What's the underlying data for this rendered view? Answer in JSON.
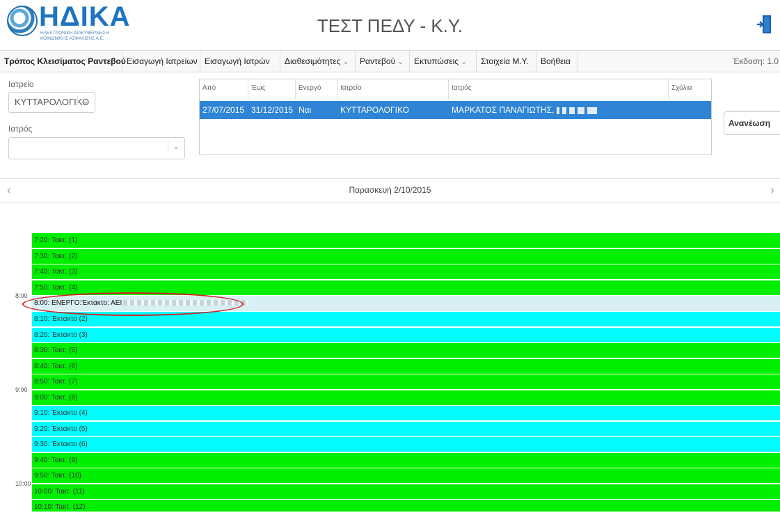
{
  "header": {
    "logo_name": "ΗΔΙΚΑ",
    "logo_sub": "ΗΛΕΚΤΡΟΝΙΚΗ ΔΙΑΚΥΒΕΡΝΗΣΗ ΚΟΙΝΩΝΙΚΗΣ ΑΣΦΑΛΙΣΗΣ Α.Ε.",
    "title": "ΤΕΣΤ ΠΕΔΥ - Κ.Υ."
  },
  "nav": {
    "items": [
      {
        "label": "Τρόπος Κλεισίματος Ραντεβού"
      },
      {
        "label": "Εισαγωγή Ιατρείων"
      },
      {
        "label": "Εισαγωγή Ιατρών"
      },
      {
        "label": "Διαθεσιμότητες"
      },
      {
        "label": "Ραντεβού"
      },
      {
        "label": "Εκτυπώσεις"
      },
      {
        "label": "Στοιχεία Μ.Υ."
      },
      {
        "label": "Βοήθεια"
      }
    ],
    "version": "Έκδοση: 1.0"
  },
  "filters": {
    "office_label": "Ιατρείο",
    "office_value": "ΚΥΤΤΑΡΟΛΟΓΙΚΟ",
    "doctor_label": "Ιατρός",
    "doctor_value": ""
  },
  "grid": {
    "headers": [
      "Από",
      "Έως",
      "Ενεργό",
      "Ιατρείο",
      "Ιατρός",
      "Σχόλια"
    ],
    "rows": [
      {
        "from": "27/07/2015",
        "to": "31/12/2015",
        "active": "Ναι",
        "office": "ΚΥΤΤΑΡΟΛΟΓΙΚΟ",
        "doctor": "ΜΑΡΚΑΤΟΣ ΠΑΝΑΓΙΩΤΗΣ,",
        "comments": ""
      }
    ]
  },
  "refresh_label": "Ανανέωση",
  "day": {
    "title": "Παρασκευή 2/10/2015",
    "prev": "‹",
    "next": "›"
  },
  "hours": [
    "8:00",
    "9:00",
    "10:00"
  ],
  "slots": [
    {
      "label": "7:20: Τακτ. (1)",
      "kind": "green"
    },
    {
      "label": "7:30: Τακτ. (2)",
      "kind": "green"
    },
    {
      "label": "7:40: Τακτ. (3)",
      "kind": "green"
    },
    {
      "label": "7:50: Τακτ. (4)",
      "kind": "green"
    },
    {
      "label": "8:00: ΕΝΕΡΓΟ:Έκτακτο: ΑΕΙ",
      "kind": "active"
    },
    {
      "label": "8:10: Έκτακτο (2)",
      "kind": "cyan"
    },
    {
      "label": "8:20: Έκτακτο (3)",
      "kind": "cyan"
    },
    {
      "label": "8:30: Τακτ. (5)",
      "kind": "green"
    },
    {
      "label": "8:40: Τακτ. (6)",
      "kind": "green"
    },
    {
      "label": "8:50: Τακτ. (7)",
      "kind": "green"
    },
    {
      "label": "9:00: Τακτ. (8)",
      "kind": "green"
    },
    {
      "label": "9:10: Έκτακτο (4)",
      "kind": "cyan"
    },
    {
      "label": "9:20: Έκτακτο (5)",
      "kind": "cyan"
    },
    {
      "label": "9:30: Έκτακτο (6)",
      "kind": "cyan"
    },
    {
      "label": "9:40: Τακτ. (9)",
      "kind": "green"
    },
    {
      "label": "9:50: Τακτ. (10)",
      "kind": "green"
    },
    {
      "label": "10:00: Τακτ. (11)",
      "kind": "green"
    },
    {
      "label": "10:10: Τακτ. (12)",
      "kind": "green"
    }
  ]
}
